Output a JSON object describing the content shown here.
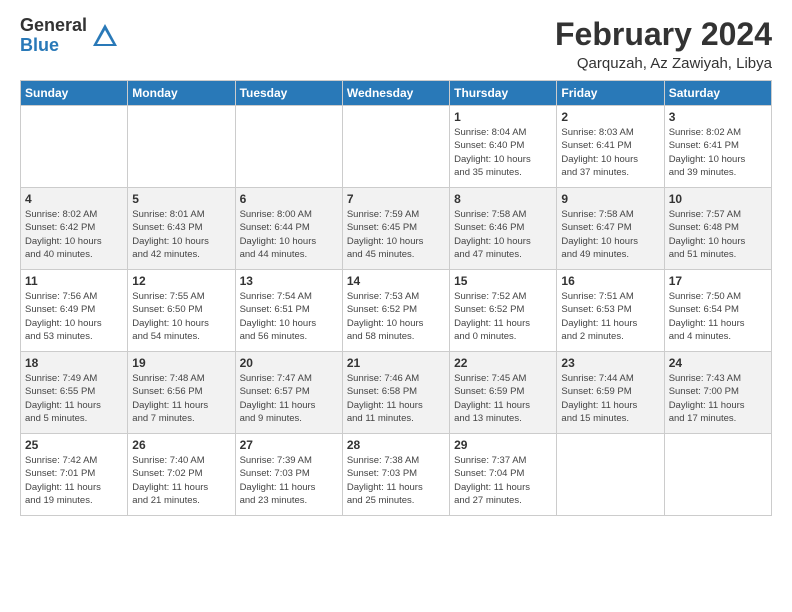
{
  "logo": {
    "general": "General",
    "blue": "Blue"
  },
  "title": {
    "month_year": "February 2024",
    "location": "Qarquzah, Az Zawiyah, Libya"
  },
  "headers": [
    "Sunday",
    "Monday",
    "Tuesday",
    "Wednesday",
    "Thursday",
    "Friday",
    "Saturday"
  ],
  "weeks": [
    [
      {
        "num": "",
        "info": ""
      },
      {
        "num": "",
        "info": ""
      },
      {
        "num": "",
        "info": ""
      },
      {
        "num": "",
        "info": ""
      },
      {
        "num": "1",
        "info": "Sunrise: 8:04 AM\nSunset: 6:40 PM\nDaylight: 10 hours\nand 35 minutes."
      },
      {
        "num": "2",
        "info": "Sunrise: 8:03 AM\nSunset: 6:41 PM\nDaylight: 10 hours\nand 37 minutes."
      },
      {
        "num": "3",
        "info": "Sunrise: 8:02 AM\nSunset: 6:41 PM\nDaylight: 10 hours\nand 39 minutes."
      }
    ],
    [
      {
        "num": "4",
        "info": "Sunrise: 8:02 AM\nSunset: 6:42 PM\nDaylight: 10 hours\nand 40 minutes."
      },
      {
        "num": "5",
        "info": "Sunrise: 8:01 AM\nSunset: 6:43 PM\nDaylight: 10 hours\nand 42 minutes."
      },
      {
        "num": "6",
        "info": "Sunrise: 8:00 AM\nSunset: 6:44 PM\nDaylight: 10 hours\nand 44 minutes."
      },
      {
        "num": "7",
        "info": "Sunrise: 7:59 AM\nSunset: 6:45 PM\nDaylight: 10 hours\nand 45 minutes."
      },
      {
        "num": "8",
        "info": "Sunrise: 7:58 AM\nSunset: 6:46 PM\nDaylight: 10 hours\nand 47 minutes."
      },
      {
        "num": "9",
        "info": "Sunrise: 7:58 AM\nSunset: 6:47 PM\nDaylight: 10 hours\nand 49 minutes."
      },
      {
        "num": "10",
        "info": "Sunrise: 7:57 AM\nSunset: 6:48 PM\nDaylight: 10 hours\nand 51 minutes."
      }
    ],
    [
      {
        "num": "11",
        "info": "Sunrise: 7:56 AM\nSunset: 6:49 PM\nDaylight: 10 hours\nand 53 minutes."
      },
      {
        "num": "12",
        "info": "Sunrise: 7:55 AM\nSunset: 6:50 PM\nDaylight: 10 hours\nand 54 minutes."
      },
      {
        "num": "13",
        "info": "Sunrise: 7:54 AM\nSunset: 6:51 PM\nDaylight: 10 hours\nand 56 minutes."
      },
      {
        "num": "14",
        "info": "Sunrise: 7:53 AM\nSunset: 6:52 PM\nDaylight: 10 hours\nand 58 minutes."
      },
      {
        "num": "15",
        "info": "Sunrise: 7:52 AM\nSunset: 6:52 PM\nDaylight: 11 hours\nand 0 minutes."
      },
      {
        "num": "16",
        "info": "Sunrise: 7:51 AM\nSunset: 6:53 PM\nDaylight: 11 hours\nand 2 minutes."
      },
      {
        "num": "17",
        "info": "Sunrise: 7:50 AM\nSunset: 6:54 PM\nDaylight: 11 hours\nand 4 minutes."
      }
    ],
    [
      {
        "num": "18",
        "info": "Sunrise: 7:49 AM\nSunset: 6:55 PM\nDaylight: 11 hours\nand 5 minutes."
      },
      {
        "num": "19",
        "info": "Sunrise: 7:48 AM\nSunset: 6:56 PM\nDaylight: 11 hours\nand 7 minutes."
      },
      {
        "num": "20",
        "info": "Sunrise: 7:47 AM\nSunset: 6:57 PM\nDaylight: 11 hours\nand 9 minutes."
      },
      {
        "num": "21",
        "info": "Sunrise: 7:46 AM\nSunset: 6:58 PM\nDaylight: 11 hours\nand 11 minutes."
      },
      {
        "num": "22",
        "info": "Sunrise: 7:45 AM\nSunset: 6:59 PM\nDaylight: 11 hours\nand 13 minutes."
      },
      {
        "num": "23",
        "info": "Sunrise: 7:44 AM\nSunset: 6:59 PM\nDaylight: 11 hours\nand 15 minutes."
      },
      {
        "num": "24",
        "info": "Sunrise: 7:43 AM\nSunset: 7:00 PM\nDaylight: 11 hours\nand 17 minutes."
      }
    ],
    [
      {
        "num": "25",
        "info": "Sunrise: 7:42 AM\nSunset: 7:01 PM\nDaylight: 11 hours\nand 19 minutes."
      },
      {
        "num": "26",
        "info": "Sunrise: 7:40 AM\nSunset: 7:02 PM\nDaylight: 11 hours\nand 21 minutes."
      },
      {
        "num": "27",
        "info": "Sunrise: 7:39 AM\nSunset: 7:03 PM\nDaylight: 11 hours\nand 23 minutes."
      },
      {
        "num": "28",
        "info": "Sunrise: 7:38 AM\nSunset: 7:03 PM\nDaylight: 11 hours\nand 25 minutes."
      },
      {
        "num": "29",
        "info": "Sunrise: 7:37 AM\nSunset: 7:04 PM\nDaylight: 11 hours\nand 27 minutes."
      },
      {
        "num": "",
        "info": ""
      },
      {
        "num": "",
        "info": ""
      }
    ]
  ]
}
